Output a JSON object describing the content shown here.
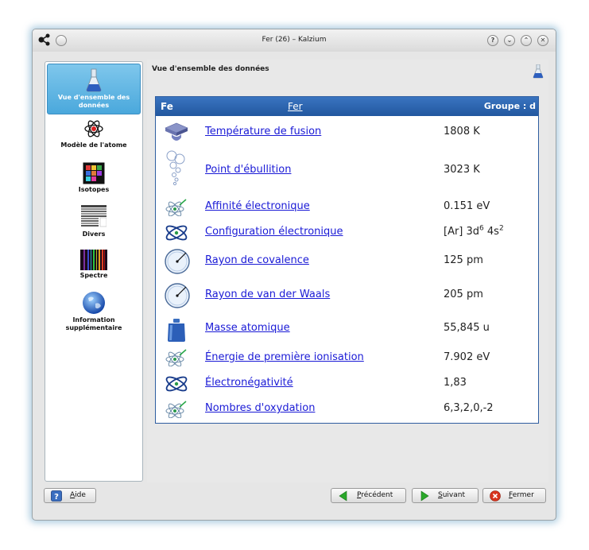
{
  "window": {
    "title": "Fer (26) – Kalzium"
  },
  "sidebar": {
    "items": [
      {
        "label": "Vue d'ensemble des données",
        "icon": "flask-icon",
        "active": true
      },
      {
        "label": "Modèle de l'atome",
        "icon": "atom-model-icon",
        "active": false
      },
      {
        "label": "Isotopes",
        "icon": "isotopes-icon",
        "active": false
      },
      {
        "label": "Divers",
        "icon": "misc-icon",
        "active": false
      },
      {
        "label": "Spectre",
        "icon": "spectrum-icon",
        "active": false
      },
      {
        "label": "Information supplémentaire",
        "icon": "globe-icon",
        "active": false
      }
    ]
  },
  "main": {
    "page_title": "Vue d'ensemble des données",
    "header": {
      "symbol": "Fe",
      "name": "Fer",
      "group": "Groupe : d"
    },
    "rows": [
      {
        "label": "Température de fusion",
        "value": "1808 K",
        "icon": "melting-icon"
      },
      {
        "label": "Point d'ébullition",
        "value": "3023 K",
        "icon": "boiling-bubbles-icon"
      },
      {
        "label": "Affinité électronique",
        "value": "0.151 eV",
        "icon": "electron-affinity-icon"
      },
      {
        "label": "Configuration électronique",
        "value_prefix": "[Ar] 3d",
        "value_sup1": "6",
        "value_mid": " 4s",
        "value_sup2": "2",
        "icon": "orbit-icon"
      },
      {
        "label": "Rayon de covalence",
        "value": "125 pm",
        "icon": "radius-icon"
      },
      {
        "label": "Rayon de van der Waals",
        "value": "205 pm",
        "icon": "radius-icon"
      },
      {
        "label": "Masse atomique",
        "value": "55,845 u",
        "icon": "weight-icon"
      },
      {
        "label": "Énergie de première ionisation",
        "value": "7.902 eV",
        "icon": "ionization-icon"
      },
      {
        "label": "Électronégativité",
        "value": "1,83",
        "icon": "orbit-icon"
      },
      {
        "label": "Nombres d'oxydation",
        "value": "6,3,2,0,-2",
        "icon": "oxidation-icon"
      }
    ]
  },
  "buttons": {
    "help": {
      "label_u": "A",
      "label_rest": "ide"
    },
    "previous": {
      "label_u": "P",
      "label_rest": "récédent"
    },
    "next": {
      "label_u": "S",
      "label_rest": "uivant"
    },
    "close": {
      "label_u": "F",
      "label_rest": "ermer"
    }
  },
  "colors": {
    "header_blue": "#2a62ad",
    "link": "#1a1ad6",
    "sidebar_active": "#5db4e2"
  }
}
